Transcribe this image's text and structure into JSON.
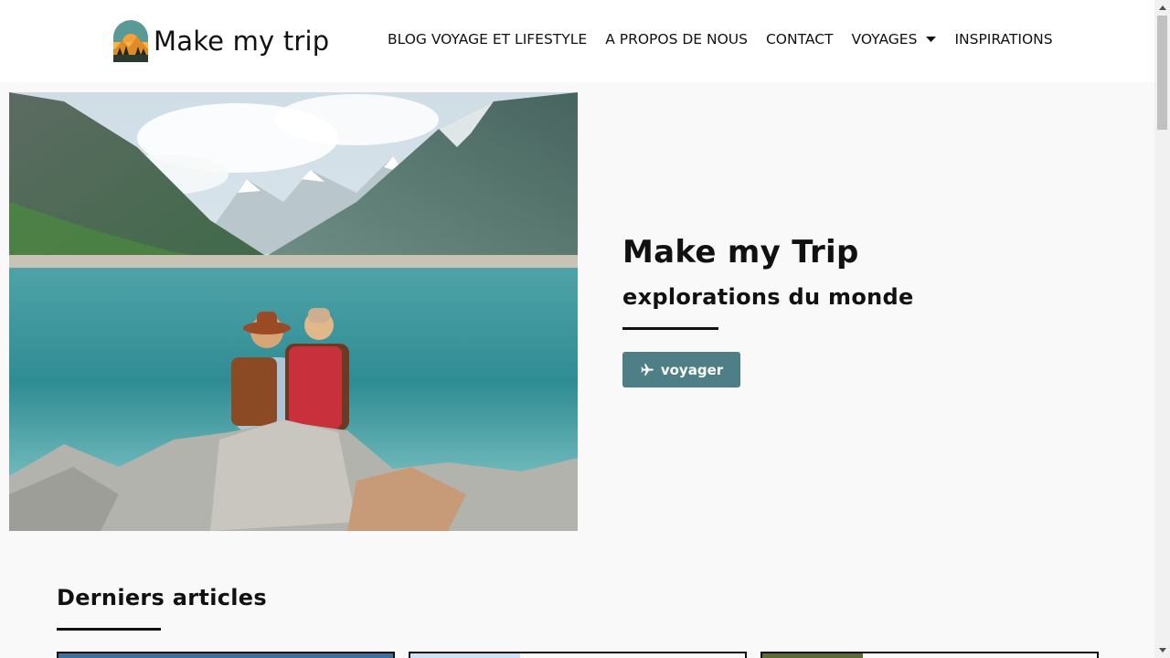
{
  "brand": {
    "name": "Make my trip",
    "icon": "mountain-logo-icon"
  },
  "nav": {
    "items": [
      {
        "label": "BLOG VOYAGE ET LIFESTYLE"
      },
      {
        "label": "A PROPOS DE NOUS"
      },
      {
        "label": "CONTACT"
      },
      {
        "label": "VOYAGES",
        "has_dropdown": true
      },
      {
        "label": "INSPIRATIONS"
      }
    ]
  },
  "hero": {
    "image": "couple-with-backpacks-at-mountain-lake-photo",
    "title": "Make my Trip",
    "subtitle": "explorations du monde",
    "button_label": "voyager",
    "button_icon": "airplane-icon"
  },
  "articles": {
    "title": "Derniers articles"
  },
  "colors": {
    "accent": "#4f7f86",
    "background": "#f9f9f9",
    "header": "#ffffff",
    "text": "#111111"
  }
}
